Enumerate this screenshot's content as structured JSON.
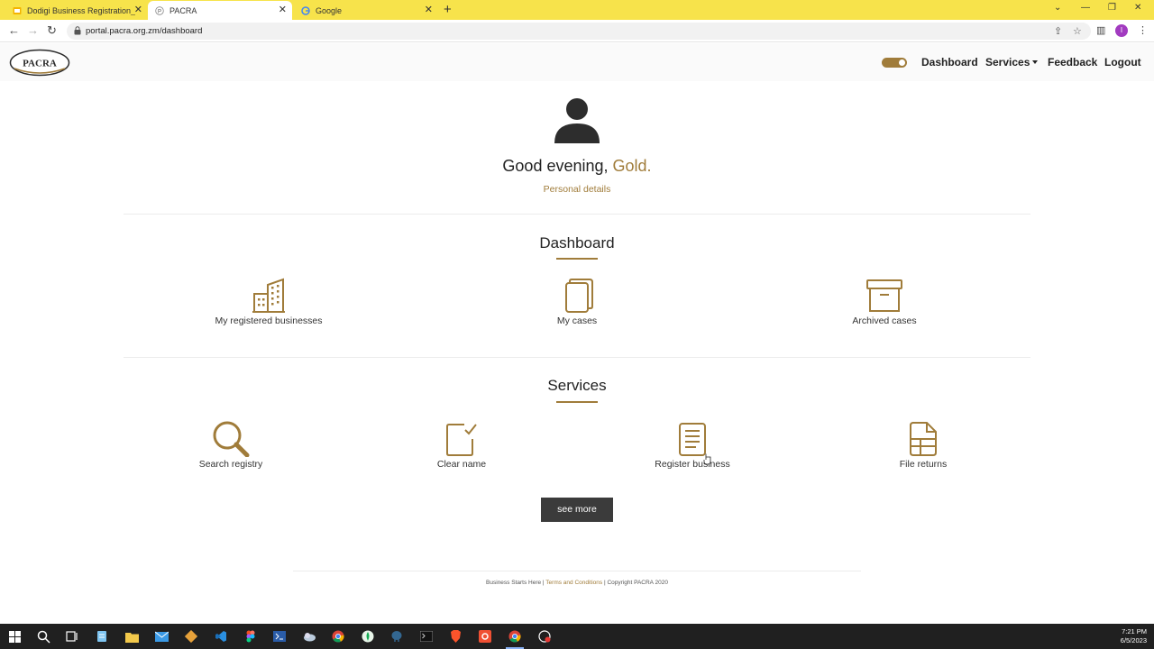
{
  "browser": {
    "tabs": [
      {
        "title": "Dodigi Business Registration_ZM",
        "active": false
      },
      {
        "title": "PACRA",
        "active": true
      },
      {
        "title": "Google",
        "active": false
      }
    ],
    "url": "portal.pacra.org.zm/dashboard",
    "profile_initial": "I"
  },
  "header": {
    "logo_text": "PACRA",
    "nav": {
      "dashboard": "Dashboard",
      "services": "Services",
      "feedback": "Feedback",
      "logout": "Logout"
    }
  },
  "profile": {
    "greeting": "Good evening,",
    "name": "Gold.",
    "details_link": "Personal details"
  },
  "dashboard": {
    "title": "Dashboard",
    "items": [
      {
        "label": "My registered businesses",
        "icon": "building-icon"
      },
      {
        "label": "My cases",
        "icon": "cases-icon"
      },
      {
        "label": "Archived cases",
        "icon": "archive-box-icon"
      }
    ]
  },
  "services": {
    "title": "Services",
    "items": [
      {
        "label": "Search registry",
        "icon": "search-icon"
      },
      {
        "label": "Clear name",
        "icon": "check-square-icon"
      },
      {
        "label": "Register business",
        "icon": "document-icon"
      },
      {
        "label": "File returns",
        "icon": "file-table-icon"
      }
    ],
    "see_more": "see more"
  },
  "footer": {
    "tagline": "Business Starts Here",
    "sep1": " | ",
    "terms": "Terms and Conditions",
    "sep2": " | ",
    "copyright": "Copyright PACRA 2020"
  },
  "taskbar": {
    "time": "7:21 PM",
    "date": "6/5/2023"
  },
  "colors": {
    "accent": "#a07c3a",
    "tabbar": "#f7e34b",
    "button": "#3b3b3b"
  }
}
